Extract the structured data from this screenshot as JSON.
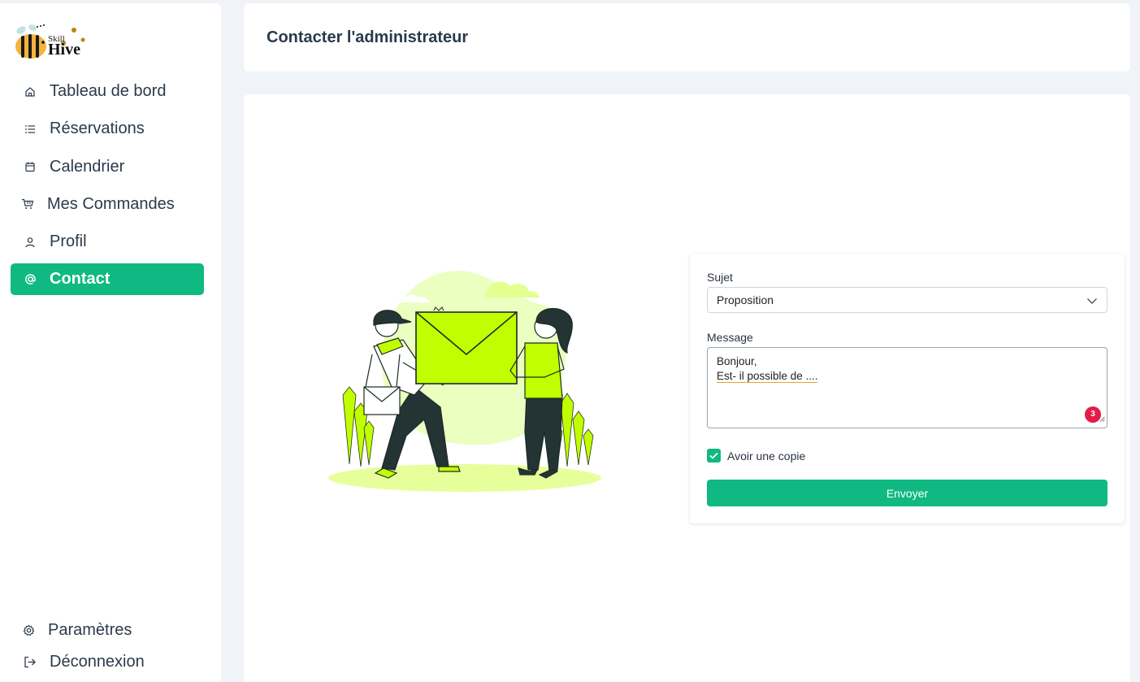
{
  "brand": {
    "name_top": "Skill",
    "name_bottom": "Hive"
  },
  "sidebar": {
    "items": [
      {
        "label": "Tableau de bord",
        "icon": "home-icon"
      },
      {
        "label": "Réservations",
        "icon": "list-icon"
      },
      {
        "label": "Calendrier",
        "icon": "calendar-icon"
      },
      {
        "label": "Mes Commandes",
        "icon": "cart-icon"
      },
      {
        "label": "Profil",
        "icon": "user-icon"
      },
      {
        "label": "Contact",
        "icon": "at-icon",
        "active": true
      }
    ],
    "bottom_items": [
      {
        "label": "Paramètres",
        "icon": "gear-icon"
      },
      {
        "label": "Déconnexion",
        "icon": "logout-icon"
      }
    ]
  },
  "header": {
    "title": "Contacter l'administrateur"
  },
  "form": {
    "subject_label": "Sujet",
    "subject_value": "Proposition",
    "message_label": "Message",
    "message_line1": "Bonjour,",
    "message_line2": "Est- il possible de ....",
    "error_count": "3",
    "copy_label": "Avoir une copie",
    "copy_checked": true,
    "submit_label": "Envoyer"
  },
  "colors": {
    "accent": "#10b981",
    "illustration": "#c1ff00",
    "badge": "#e11d48"
  }
}
